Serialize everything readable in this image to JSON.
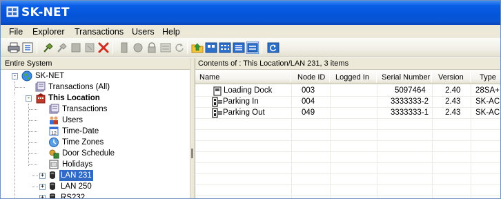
{
  "app": {
    "title": "SK-NET"
  },
  "menu": [
    "File",
    "Explorer",
    "Transactions",
    "Users",
    "Help"
  ],
  "panes": {
    "left_header": "Entire System",
    "right_header": "Contents of : This Location/LAN 231, 3 items"
  },
  "tree": {
    "root": "SK-NET",
    "transactions_all": "Transactions (All)",
    "this_location": "This Location",
    "children": [
      "Transactions",
      "Users",
      "Time-Date",
      "Time Zones",
      "Door Schedule",
      "Holidays"
    ],
    "lans": [
      "LAN 231",
      "LAN 250",
      "RS232"
    ],
    "selected": "LAN 231"
  },
  "table": {
    "columns": [
      "Name",
      "Node ID",
      "Logged In",
      "Serial Number",
      "Version",
      "Type"
    ],
    "rows": [
      {
        "name": "Loading Dock",
        "node_id": "003",
        "logged_in": "",
        "serial": "5097464",
        "version": "2.40",
        "type": "28SA+"
      },
      {
        "name": "Parking In",
        "node_id": "004",
        "logged_in": "",
        "serial": "3333333-2",
        "version": "2.43",
        "type": "SK-ACP"
      },
      {
        "name": "Parking Out",
        "node_id": "049",
        "logged_in": "",
        "serial": "3333333-1",
        "version": "2.43",
        "type": "SK-ACP"
      }
    ]
  },
  "colors": {
    "title_bar": "#0454d8",
    "selection": "#316ac5",
    "chrome": "#ece9d8"
  },
  "icons": {
    "toolbar": [
      "print-icon",
      "properties-icon",
      "connect-icon",
      "disconnect-icon",
      "card-icon",
      "card-disabled-icon",
      "delete-icon",
      "door-icon",
      "unlock-icon",
      "lock-icon",
      "list-disabled-icon",
      "refresh-disabled-icon",
      "up-folder-icon",
      "large-icons-icon",
      "small-icons-icon",
      "details-view-icon",
      "refresh-icon"
    ]
  }
}
